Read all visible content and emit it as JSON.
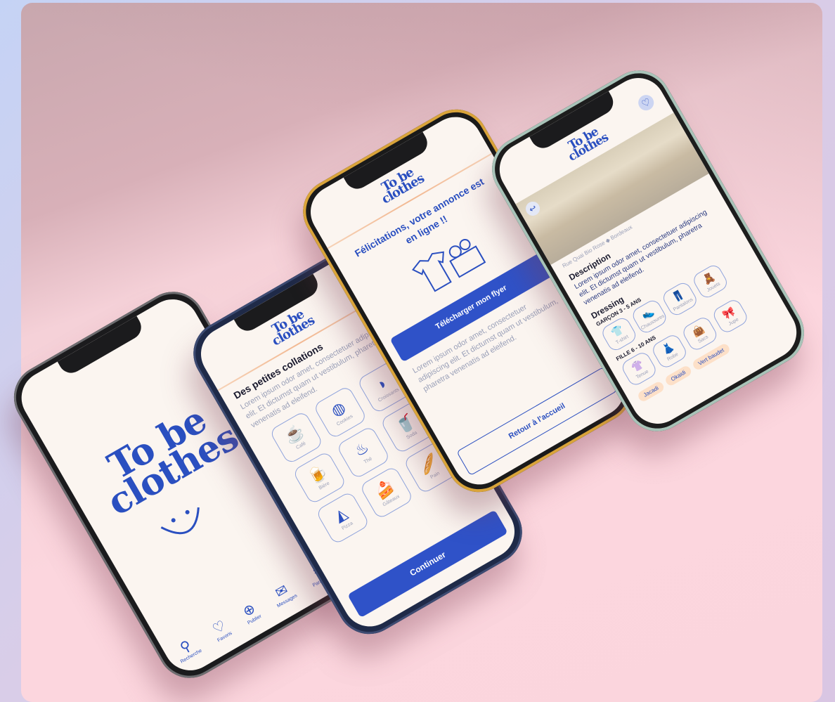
{
  "brand": {
    "logo_line1": "To be",
    "logo_line2": "clothes"
  },
  "phone1": {
    "nav": [
      {
        "icon": "search-icon",
        "glyph": "⚲",
        "label": "Recherche"
      },
      {
        "icon": "heart-icon",
        "glyph": "♡",
        "label": "Favoris"
      },
      {
        "icon": "plus-circle-icon",
        "glyph": "⊕",
        "label": "Publier"
      },
      {
        "icon": "message-icon",
        "glyph": "✉",
        "label": "Messages"
      },
      {
        "icon": "settings-icon",
        "glyph": "⚙",
        "label": "Paramètres"
      }
    ]
  },
  "phone2": {
    "title": "Des petites collations",
    "text": "Lorem ipsum odor amet, consectetuer adipiscing elit. Et dictumst quam ut vestibulum, pharetra venenatis ad eleifend.",
    "snacks": [
      {
        "icon": "coffee-pot-icon",
        "glyph": "☕",
        "label": "Café"
      },
      {
        "icon": "cookie-icon",
        "glyph": "◍",
        "label": "Cookies"
      },
      {
        "icon": "croissant-icon",
        "glyph": "◗",
        "label": "Croissants"
      },
      {
        "icon": "beer-icon",
        "glyph": "🍺",
        "label": "Bière"
      },
      {
        "icon": "teapot-icon",
        "glyph": "♨",
        "label": "Thé"
      },
      {
        "icon": "soda-icon",
        "glyph": "🥤",
        "label": "Soda"
      },
      {
        "icon": "pizza-icon",
        "glyph": "◭",
        "label": "Pizza"
      },
      {
        "icon": "cake-icon",
        "glyph": "🍰",
        "label": "Gâteaux"
      },
      {
        "icon": "bread-icon",
        "glyph": "🥖",
        "label": "Pain"
      }
    ],
    "button": "Continuer"
  },
  "phone3": {
    "title": "Félicitations, votre annonce est en ligne !!",
    "download_button": "Télécharger mon flyer",
    "text": "Lorem ipsum odor amet, consectetuer adipiscing elit. Et dictumst quam ut vestibulum, pharetra venenatis ad eleifend.",
    "back_button": "Retour à l'accueil"
  },
  "phone4": {
    "subtitle": "Rue Quai Bio Rose ◆ Bordeaux",
    "description_title": "Description",
    "description_text": "Lorem ipsum odor amet, consectetuer adipiscing elit. Et dictumst quam ut vestibulum, pharetra venenatis ad eleifend.",
    "dressing_title": "Dressing",
    "group1": "GARÇON 3 - 5 ANS",
    "group2": "FILLE 6 - 10 ANS",
    "items1": [
      "T-shirt",
      "Chaussures",
      "Pantalons",
      "Jouets"
    ],
    "items2": [
      "Tenue",
      "Robe",
      "Sacs",
      "Jupe"
    ],
    "tags": [
      "Jacadi",
      "Okaidi",
      "Vert baudet"
    ]
  }
}
